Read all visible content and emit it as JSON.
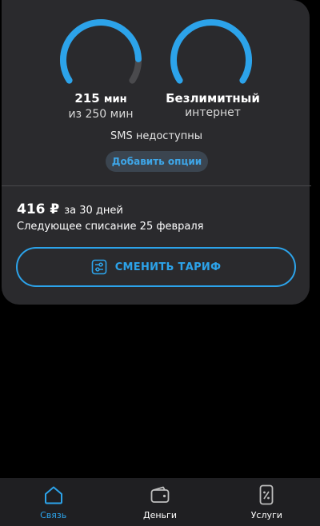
{
  "tariff": {
    "minutes": {
      "value": "215",
      "unit": "мин",
      "total_text": "из 250 мин",
      "used_fraction": 0.86
    },
    "internet": {
      "title": "Безлимитный",
      "subtitle": "интернет"
    },
    "sms_note": "SMS недоступны",
    "add_options_label": "Добавить опции",
    "price": {
      "amount": "416 ₽",
      "period": "за 30 дней"
    },
    "next_charge": "Следующее списание 25 февраля",
    "change_tariff_label": "СМЕНИТЬ ТАРИФ"
  },
  "colors": {
    "accent": "#2ca3ea",
    "card_bg": "#2a2a2d",
    "gauge_track": "#4a4a4d"
  },
  "icons": {
    "change_tariff": "sliders-icon",
    "nav_home": "home-icon",
    "nav_money": "wallet-icon",
    "nav_services": "phone-percent-icon"
  },
  "nav": {
    "items": [
      {
        "label": "Связь",
        "active": true
      },
      {
        "label": "Деньги",
        "active": false
      },
      {
        "label": "Услуги",
        "active": false
      }
    ]
  }
}
